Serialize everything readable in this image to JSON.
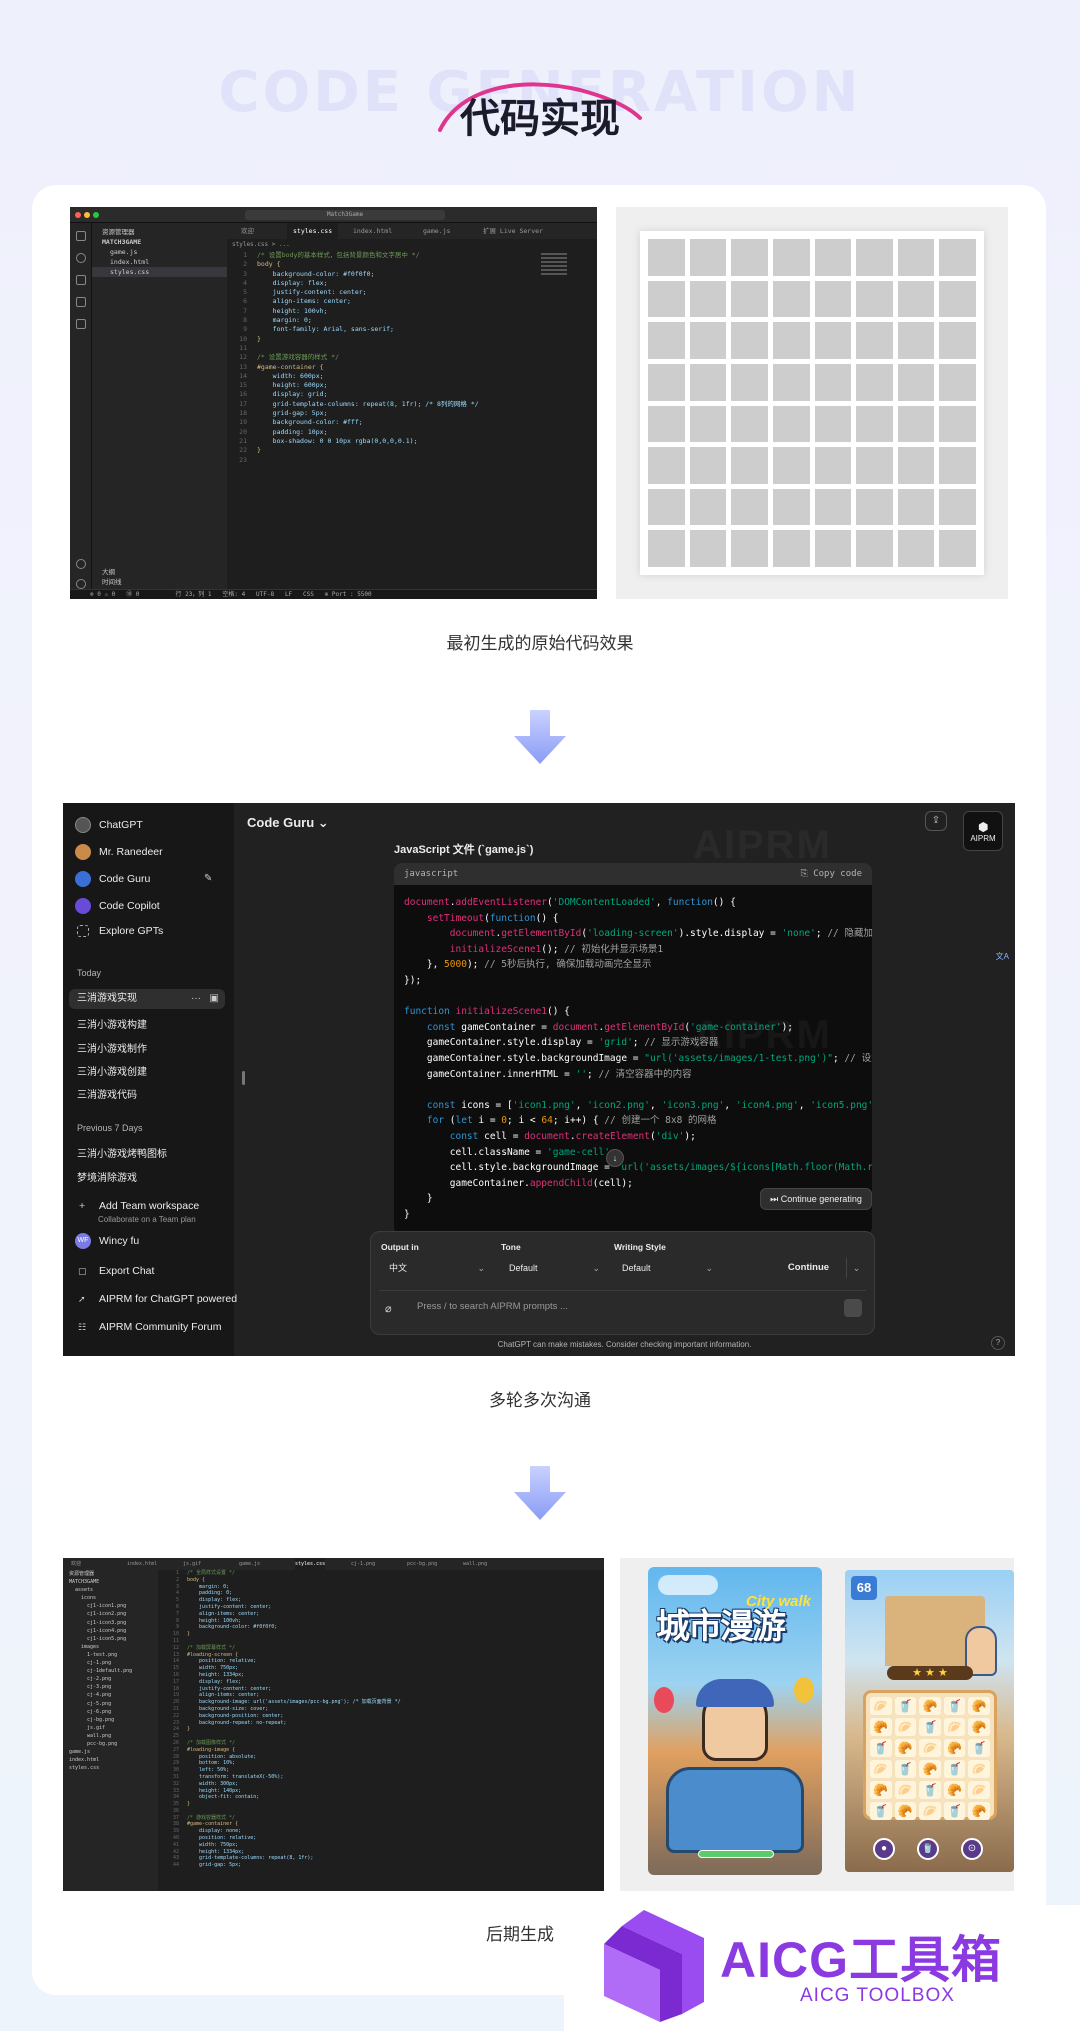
{
  "header": {
    "bg_text": "CODE GENERATION",
    "title": "代码实现"
  },
  "captions": {
    "first": "最初生成的原始代码效果",
    "second": "多轮多次沟通",
    "third": "后期生成"
  },
  "vscode1": {
    "search": "Match3Game",
    "explorer_title": "资源管理器",
    "project": "MATCH3GAME",
    "files": [
      "game.js",
      "index.html",
      "styles.css"
    ],
    "outline": "大纲",
    "timeline": "时间线",
    "tabs": [
      "欢迎",
      "styles.css",
      "index.html",
      "game.js",
      "扩展 Live Server"
    ],
    "breadcrumb": "styles.css > ...",
    "code_lines": [
      {
        "n": "1",
        "t": "/* 设置body的基本样式，包括背景颜色和文字居中 */",
        "c": "c-com"
      },
      {
        "n": "2",
        "t": "body {",
        "c": "c-sel"
      },
      {
        "n": "3",
        "t": "    background-color: #f0f0f0;",
        "c": "c-prop"
      },
      {
        "n": "4",
        "t": "    display: flex;",
        "c": "c-prop"
      },
      {
        "n": "5",
        "t": "    justify-content: center;",
        "c": "c-prop"
      },
      {
        "n": "6",
        "t": "    align-items: center;",
        "c": "c-prop"
      },
      {
        "n": "7",
        "t": "    height: 100vh;",
        "c": "c-prop"
      },
      {
        "n": "8",
        "t": "    margin: 0;",
        "c": "c-prop"
      },
      {
        "n": "9",
        "t": "    font-family: Arial, sans-serif;",
        "c": "c-prop"
      },
      {
        "n": "10",
        "t": "}",
        "c": "c-sel"
      },
      {
        "n": "11",
        "t": "",
        "c": "c-txt"
      },
      {
        "n": "12",
        "t": "/* 设置游戏容器的样式 */",
        "c": "c-com"
      },
      {
        "n": "13",
        "t": "#game-container {",
        "c": "c-sel"
      },
      {
        "n": "14",
        "t": "    width: 600px;",
        "c": "c-prop"
      },
      {
        "n": "15",
        "t": "    height: 600px;",
        "c": "c-prop"
      },
      {
        "n": "16",
        "t": "    display: grid;",
        "c": "c-prop"
      },
      {
        "n": "17",
        "t": "    grid-template-columns: repeat(8, 1fr); /* 8列的网格 */",
        "c": "c-prop"
      },
      {
        "n": "18",
        "t": "    grid-gap: 5px;",
        "c": "c-prop"
      },
      {
        "n": "19",
        "t": "    background-color: #fff;",
        "c": "c-prop"
      },
      {
        "n": "20",
        "t": "    padding: 10px;",
        "c": "c-prop"
      },
      {
        "n": "21",
        "t": "    box-shadow: 0 0 10px rgba(0,0,0,0.1);",
        "c": "c-prop"
      },
      {
        "n": "22",
        "t": "}",
        "c": "c-sel"
      },
      {
        "n": "23",
        "t": "",
        "c": "c-txt"
      }
    ],
    "status": "⊗ 0 ⚠ 0   ⑩ 0          行 23，列 1   空格: 4   UTF-8   LF   CSS   ⊕ Port : 5500"
  },
  "chatgpt": {
    "sidebar_top": [
      {
        "label": "ChatGPT",
        "color": "#333333"
      },
      {
        "label": "Mr. Ranedeer",
        "color": "#c98a4a"
      },
      {
        "label": "Code Guru",
        "color": "#3b6fd8"
      },
      {
        "label": "Code Copilot",
        "color": "#6a4ad8"
      },
      {
        "label": "Explore GPTs",
        "color": "#171717"
      }
    ],
    "today": "Today",
    "today_items": [
      "三消游戏实现",
      "三消小游戏构建",
      "三消小游戏制作",
      "三消小游戏创建",
      "三消游戏代码"
    ],
    "prev": "Previous 7 Days",
    "prev_items": [
      "三消小游戏烤鸭图标",
      "梦境消除游戏"
    ],
    "team": "Add Team workspace",
    "team_sub": "Collaborate on a Team plan",
    "user": "Wincy fu",
    "user_initials": "WF",
    "footer_items": [
      "Export Chat",
      "AIPRM for ChatGPT powered",
      "AIPRM Community Forum"
    ],
    "model": "Code Guru ⌄",
    "aiprm": "AIPRM",
    "heading": "JavaScript 文件 (`game.js`)",
    "code_lang": "javascript",
    "copy": "Copy code",
    "continue_gen": "Continue generating",
    "output_label": "Output in",
    "output_value": "中文",
    "tone_label": "Tone",
    "tone_value": "Default",
    "style_label": "Writing Style",
    "style_value": "Default",
    "continue_btn": "Continue",
    "placeholder": "Press / to search AIPRM prompts ...",
    "disclaimer": "ChatGPT can make mistakes. Consider checking important information.",
    "watermark": "AIPRM"
  },
  "vscode2": {
    "tabs": [
      "欢迎",
      "index.html",
      "js.gif",
      "game.js",
      "styles.css",
      "cj-1.png",
      "pcc-bg.png",
      "wall.png"
    ],
    "files": [
      "资源管理器",
      "MATCH3GAME",
      "assets",
      "icons",
      "cj1-icon1.png",
      "cj1-icon2.png",
      "cj1-icon3.png",
      "cj1-icon4.png",
      "cj1-icon5.png",
      "images",
      "1-test.png",
      "cj-1.png",
      "cj-1default.png",
      "cj-2.png",
      "cj-3.png",
      "cj-4.png",
      "cj-5.png",
      "cj-6.png",
      "cj-bg.png",
      "js.gif",
      "wall.png",
      "pcc-bg.png",
      "game.js",
      "index.html",
      "styles.css"
    ],
    "code": [
      "/* 全局样式设置 */",
      "body {",
      "    margin: 0;",
      "    padding: 0;",
      "    display: flex;",
      "    justify-content: center;",
      "    align-items: center;",
      "    height: 100vh;",
      "    background-color: #f0f0f0;",
      "}",
      "",
      "/* 加载屏幕样式 */",
      "#loading-screen {",
      "    position: relative;",
      "    width: 750px;",
      "    height: 1334px;",
      "    display: flex;",
      "    justify-content: center;",
      "    align-items: center;",
      "    background-image: url('assets/images/pcc-bg.png'); /* 加载页面背景 */",
      "    background-size: cover;",
      "    background-position: center;",
      "    background-repeat: no-repeat;",
      "}",
      "",
      "/* 加载图像样式 */",
      "#loading-image {",
      "    position: absolute;",
      "    bottom: 10%;",
      "    left: 50%;",
      "    transform: translateX(-50%);",
      "    width: 300px;",
      "    height: 140px;",
      "    object-fit: contain;",
      "}",
      "",
      "/* 游戏容器样式 */",
      "#game-container {",
      "    display: none;",
      "    position: relative;",
      "    width: 750px;",
      "    height: 1334px;",
      "    grid-template-columns: repeat(8, 1fr);",
      "    grid-gap: 5px;"
    ]
  },
  "game1": {
    "title": "城市漫游",
    "subtitle": "City walk"
  },
  "game2": {
    "level": "68",
    "stars": "★ ★ ★",
    "tiles": [
      "🥟",
      "🥤",
      "🥐",
      "🥤",
      "🥐",
      "🥐",
      "🥟",
      "🥤",
      "🥟",
      "🥐",
      "🥤",
      "🥐",
      "🥟",
      "🥐",
      "🥤",
      "🥟",
      "🥤",
      "🥐",
      "🥤",
      "🥟",
      "🥐",
      "🥟",
      "🥤",
      "🥐",
      "🥟",
      "🥤",
      "🥐",
      "🥟",
      "🥤",
      "🥐"
    ],
    "tools": [
      "●",
      "🥤",
      "⊙"
    ]
  },
  "logo": {
    "main": "AICG工具箱",
    "sub": "AICG TOOLBOX",
    "color": "#8a3ae0"
  }
}
